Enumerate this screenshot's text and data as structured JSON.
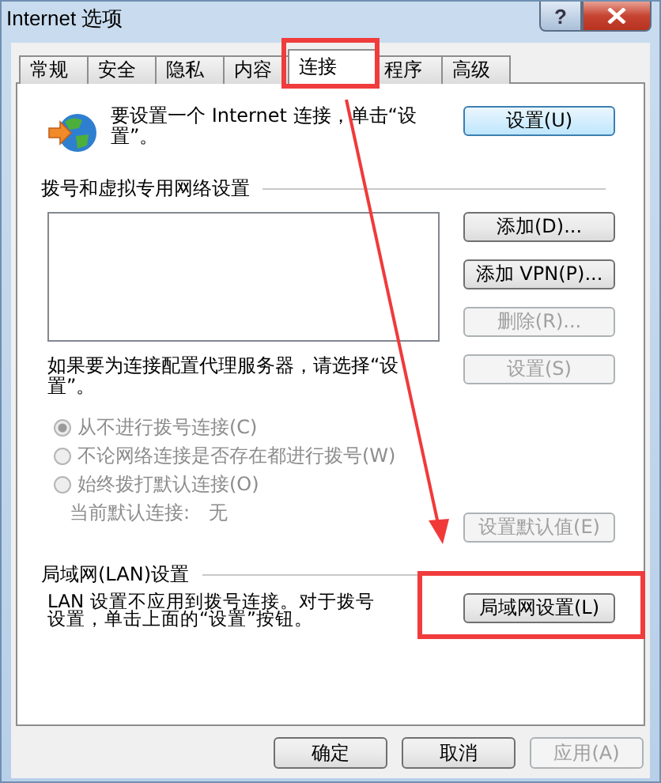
{
  "window": {
    "title": "Internet 选项",
    "help": "?"
  },
  "tabs": [
    {
      "label": "常规",
      "selected": false,
      "highlighted": false
    },
    {
      "label": "安全",
      "selected": false,
      "highlighted": false
    },
    {
      "label": "隐私",
      "selected": false,
      "highlighted": false
    },
    {
      "label": "内容",
      "selected": false,
      "highlighted": false
    },
    {
      "label": "连接",
      "selected": true,
      "highlighted": true
    },
    {
      "label": "程序",
      "selected": false,
      "highlighted": false
    },
    {
      "label": "高级",
      "selected": false,
      "highlighted": false
    }
  ],
  "setup": {
    "text": "要设置一个 Internet 连接，单击“设置”。",
    "button": {
      "label": "设置(U)",
      "disabled": false,
      "default": true
    }
  },
  "dialup": {
    "heading": "拨号和虚拟专用网络设置",
    "buttons": [
      {
        "label": "添加(D)...",
        "disabled": false
      },
      {
        "label": "添加 VPN(P)...",
        "disabled": false
      },
      {
        "label": "删除(R)...",
        "disabled": true
      },
      {
        "label": "设置(S)",
        "disabled": true
      }
    ],
    "proxy_text": "如果要为连接配置代理服务器，请选择“设置”。",
    "options": [
      {
        "label": "从不进行拨号连接(C)",
        "selected": true,
        "disabled": true
      },
      {
        "label": "不论网络连接是否存在都进行拨号(W)",
        "selected": false,
        "disabled": true
      },
      {
        "label": "始终拨打默认连接(O)",
        "selected": false,
        "disabled": true
      }
    ],
    "default_label": "当前默认连接:",
    "default_value": "无",
    "default_button": {
      "label": "设置默认值(E)",
      "disabled": true
    }
  },
  "lan": {
    "heading": "局域网(LAN)设置",
    "text": "LAN 设置不应用到拨号连接。对于拨号设置，单击上面的“设置”按钮。",
    "button": {
      "label": "局域网设置(L)",
      "disabled": false,
      "highlighted": true
    }
  },
  "footer": [
    {
      "label": "确定",
      "disabled": false
    },
    {
      "label": "取消",
      "disabled": false
    },
    {
      "label": "应用(A)",
      "disabled": true
    }
  ]
}
